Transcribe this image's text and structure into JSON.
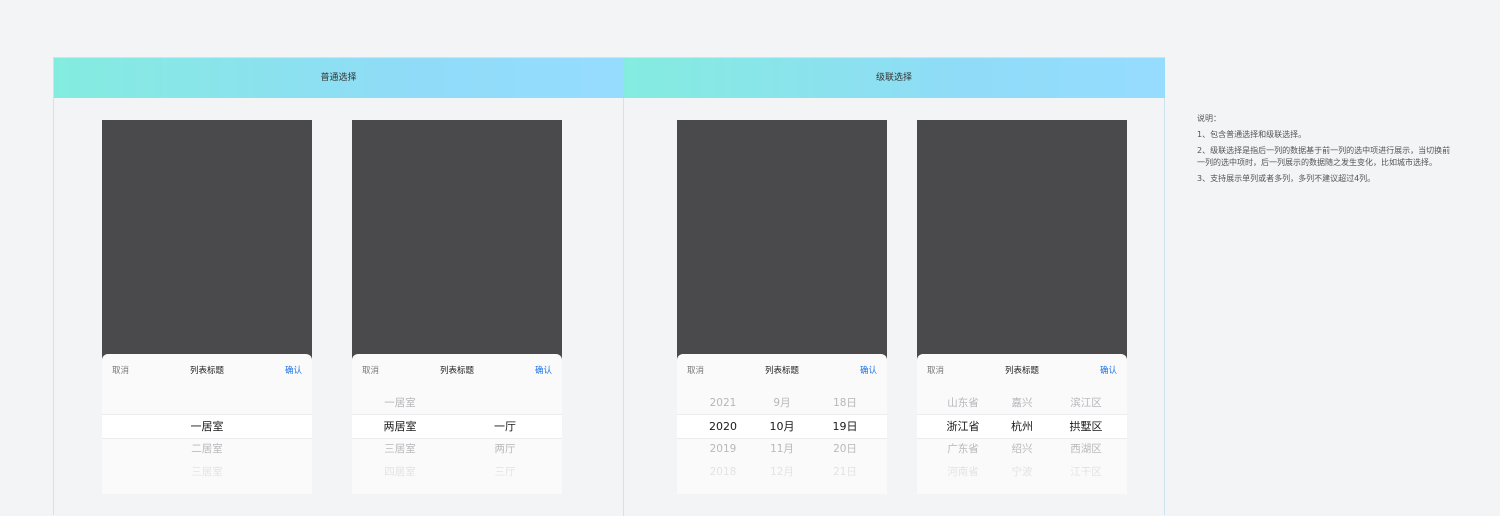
{
  "sections": [
    {
      "header": "普通选择",
      "pickers": [
        {
          "cancel": "取消",
          "title": "列表标题",
          "confirm": "确认",
          "columns": [
            {
              "items": [
                "",
                "一居室",
                "二居室",
                "三居室"
              ]
            }
          ]
        },
        {
          "cancel": "取消",
          "title": "列表标题",
          "confirm": "确认",
          "columns": [
            {
              "items": [
                "一居室",
                "两居室",
                "三居室",
                "四居室"
              ]
            },
            {
              "items": [
                "",
                "一厅",
                "两厅",
                "三厅"
              ]
            }
          ]
        }
      ]
    },
    {
      "header": "级联选择",
      "pickers": [
        {
          "cancel": "取消",
          "title": "列表标题",
          "confirm": "确认",
          "columns": [
            {
              "items": [
                "2021",
                "2020",
                "2019",
                "2018"
              ]
            },
            {
              "items": [
                "9月",
                "10月",
                "11月",
                "12月"
              ]
            },
            {
              "items": [
                "18日",
                "19日",
                "20日",
                "21日"
              ]
            }
          ]
        },
        {
          "cancel": "取消",
          "title": "列表标题",
          "confirm": "确认",
          "columns": [
            {
              "items": [
                "山东省",
                "浙江省",
                "广东省",
                "河南省"
              ]
            },
            {
              "items": [
                "嘉兴",
                "杭州",
                "绍兴",
                "宁波"
              ]
            },
            {
              "items": [
                "滨江区",
                "拱墅区",
                "西湖区",
                "江干区"
              ]
            }
          ]
        }
      ]
    }
  ],
  "notes": {
    "title": "说明：",
    "items": [
      "1、包含普通选择和级联选择。",
      "2、级联选择是指后一列的数据基于前一列的选中项进行展示，当切换前一列的选中项时，后一列展示的数据随之发生变化，比如城市选择。",
      "3、支持展示单列或者多列，多列不建议超过4列。"
    ]
  },
  "colors": {
    "accent": "#1f75e6",
    "header_start": "#84ecdf",
    "header_end": "#96dcff",
    "mask": "#4a4a4c"
  }
}
